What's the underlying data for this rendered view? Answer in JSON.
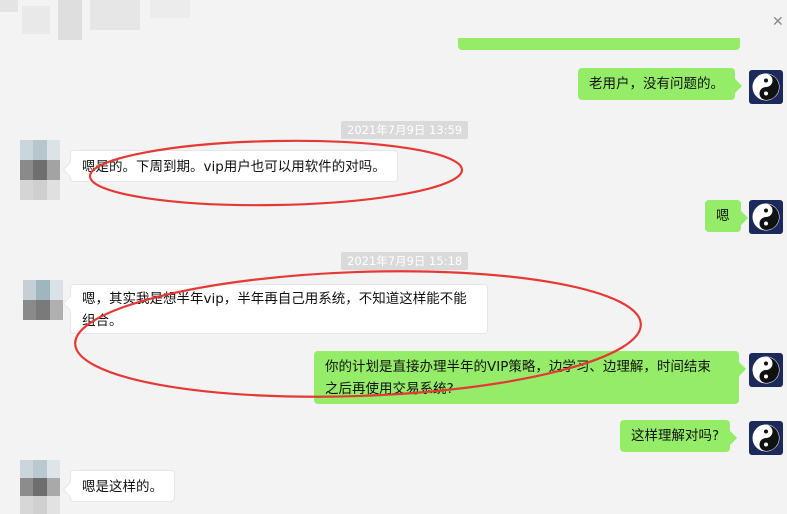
{
  "timestamps": [
    "2021年7月9日 13:59",
    "2021年7月9日 15:18"
  ],
  "messages": {
    "m1": "老用户，没有问题的。",
    "m2": "嗯是的。下周到期。vip用户也可以用软件的对吗。",
    "m3": "嗯",
    "m4_line1": "嗯，其实我是想半年vip，半年再自己用系统，不知道这样能不能",
    "m4_line2": "组合。",
    "m5_line1": "你的计划是直接办理半年的VIP策略，边学习、边理解，时间结束",
    "m5_line2": "之后再使用交易系统?",
    "m6": "这样理解对吗?",
    "m7": "嗯是这样的。"
  },
  "colors": {
    "sent_bubble": "#95ec69",
    "received_bubble": "#ffffff",
    "annotation": "#e53935"
  },
  "icons": {
    "self_avatar": "yin-yang-icon",
    "other_avatar": "blurred-avatar"
  }
}
